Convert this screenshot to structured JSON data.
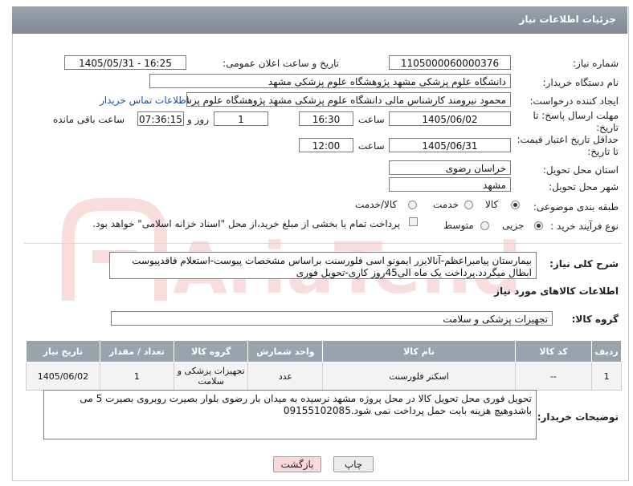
{
  "header": {
    "title": "جزئیات اطلاعات نیاز"
  },
  "fields": {
    "need_number_label": "شماره نیاز:",
    "need_number": "1105000060000376",
    "announce_label": "تاریخ و ساعت اعلان عمومی:",
    "announce_value": "1405/05/31 - 16:25",
    "buyer_org_label": "نام دستگاه خریدار:",
    "buyer_org": "دانشگاه علوم پزشکی مشهد   پژوهشگاه علوم پزشکی مشهد",
    "requester_label": "ایجاد کننده درخواست:",
    "requester": "محمود نیرومند کارشناس مالی دانشگاه علوم پزشکی مشهد   پژوهشگاه علوم پزشکی مشهد",
    "contact_link": "اطلاعات تماس خریدار",
    "reply_deadline_label_1": "مهلت ارسال پاسخ: تا",
    "reply_deadline_label_2": "تاریخ:",
    "reply_date": "1405/06/02",
    "time_label": "ساعت",
    "reply_time": "16:30",
    "days_value": "1",
    "days_label": "روز و",
    "remaining_time": "07:36:15",
    "remaining_label": "ساعت باقی مانده",
    "min_price_label_1": "حداقل تاریخ اعتبار قیمت:",
    "min_price_label_2": "تا تاریخ:",
    "price_date": "1405/06/31",
    "price_time": "12:00",
    "province_label": "استان محل تحویل:",
    "province": "خراسان رضوی",
    "city_label": "شهر محل تحویل:",
    "city": "مشهد",
    "category_label": "طبقه بندی موضوعی:",
    "cat_goods": "کالا",
    "cat_service": "خدمت",
    "cat_goods_service": "کالا/خدمت",
    "process_label": "نوع فرآیند خرید :",
    "proc_minor": "جزیی",
    "proc_medium": "متوسط",
    "payment_note": "پرداخت تمام یا بخشی از مبلغ خرید،از محل \"اسناد خزانه اسلامی\" خواهد بود.",
    "description_label": "شرح کلی نیاز:",
    "description": "بیمارستان پیامبراعظم-آنالایزر ایمونو اسی فلورسنت براساس مشخصات پیوست-استعلام فاقدپیوست ابطال میگردد.پرداخت یک ماه الی45روز کاری-تحویل فوری",
    "goods_info_title": "اطلاعات کالاهای مورد نیاز",
    "goods_group_label": "گروه کالا:",
    "goods_group": "تجهیزات پزشکی و سلامت",
    "buyer_notes_label": "توضیحات خریدار:",
    "buyer_notes": "تحویل فوری محل تحویل کالا در محل پروژه  مشهد نرسیده به میدان بار رضوی بلوار بصیرت روبروی بصیرت 5 می باشدوهیچ هزینه بابت حمل  پرداخت نمی شود.09155102085"
  },
  "table": {
    "headers": [
      "ردیف",
      "کد کالا",
      "نام کالا",
      "واحد شمارش",
      "گروه کالا",
      "تعداد / مقدار",
      "تاریخ نیاز"
    ],
    "rows": [
      [
        "1",
        "--",
        "اسکنر فلورسنت",
        "عدد",
        "تجهیزات پزشکی و سلامت",
        "1",
        "1405/06/02"
      ]
    ]
  },
  "buttons": {
    "print": "چاپ",
    "back": "بازگشت"
  },
  "watermark": {
    "text": "AriaTender.net"
  }
}
